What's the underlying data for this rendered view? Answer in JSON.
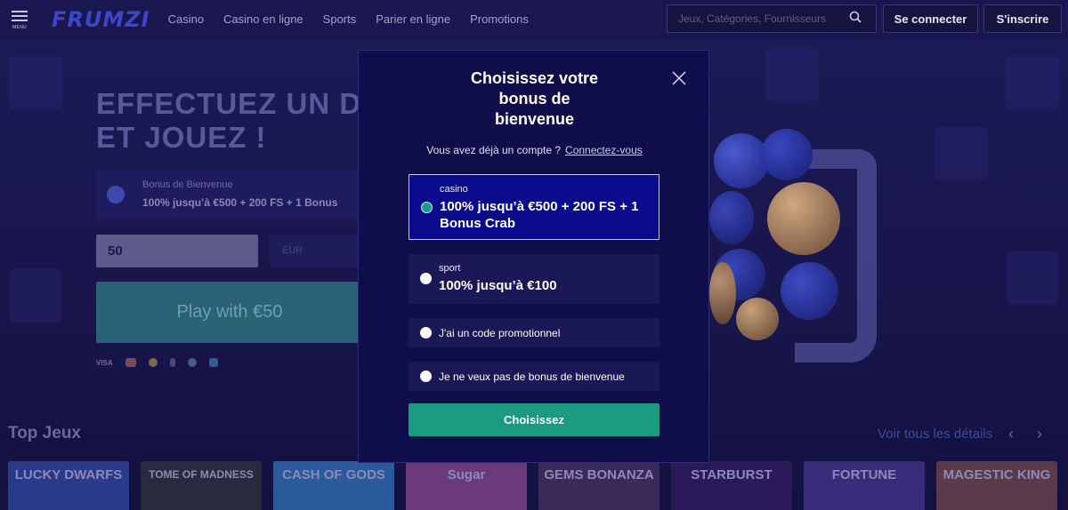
{
  "header": {
    "menu_label": "MENU",
    "logo": "FRUMZI",
    "nav": [
      "Casino",
      "Casino en ligne",
      "Sports",
      "Parier en ligne",
      "Promotions"
    ],
    "search_placeholder": "Jeux, Catégories, Fournisseurs",
    "login_label": "Se connecter",
    "register_label": "S'inscrire"
  },
  "hero": {
    "title_line1": "EFFECTUEZ UN D",
    "title_line2": "ET JOUEZ !",
    "bonus_label": "Bonus de Bienvenue",
    "bonus_value": "100% jusqu’à €500 + 200 FS + 1 Bonus",
    "amount": "50",
    "currency": "EUR",
    "play_label": "Play with €50",
    "payments": [
      "VISA",
      "mastercard",
      "bitcoin",
      "ethereum",
      "litecoin",
      "ripple"
    ]
  },
  "top_games": {
    "title": "Top Jeux",
    "see_all": "Voir tous les détails",
    "games": [
      "LUCKY DWARFS",
      "TOME OF MADNESS",
      "CASH OF GODS",
      "Sugar",
      "GEMS BONANZA",
      "STARBURST",
      "FORTUNE",
      "MAGESTIC KING"
    ]
  },
  "modal": {
    "title_line1": "Choisissez votre",
    "title_line2": "bonus de",
    "title_line3": "bienvenue",
    "account_text": "Vous avez déjà un compte ?",
    "account_link": "Connectez-vous",
    "options": [
      {
        "category": "casino",
        "value": "100% jusqu’à €500 + 200 FS + 1 Bonus Crab",
        "selected": true
      },
      {
        "category": "sport",
        "value": "100% jusqu’à €100",
        "selected": false
      }
    ],
    "promo_code_label": "J'ai un code promotionnel",
    "no_bonus_label": "Je ne veux pas de bonus de bienvenue",
    "choose_label": "Choisissez"
  },
  "colors": {
    "accent": "#1a9a7e",
    "selected_option": "#0a0a8c",
    "modal_bg": "#0f0e4a"
  }
}
